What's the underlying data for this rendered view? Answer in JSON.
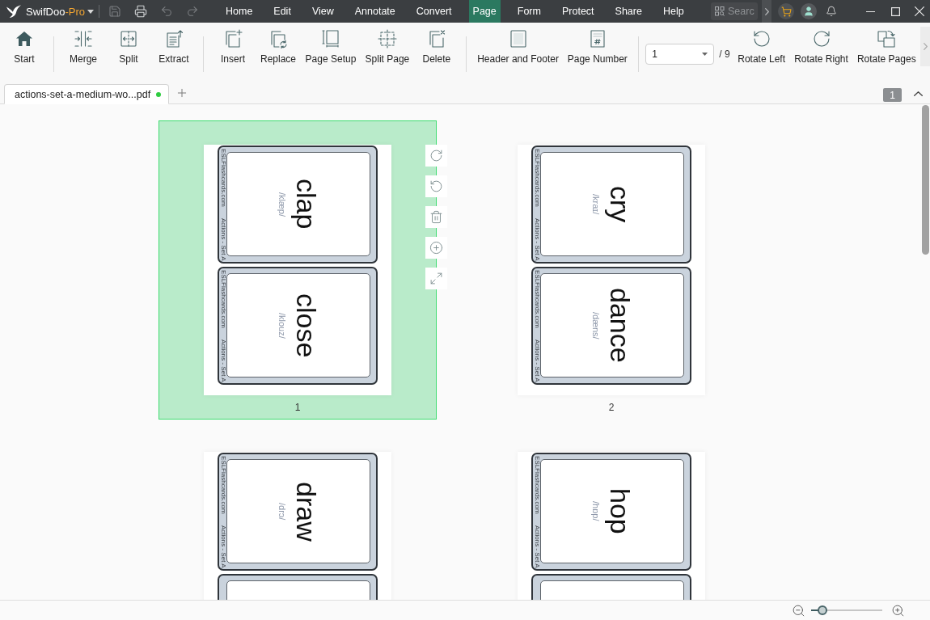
{
  "app_title": {
    "name": "SwifDoo",
    "edition": "-Pro"
  },
  "quick_actions": [
    {
      "disabled": true
    },
    {
      "disabled": false
    },
    {
      "disabled": true
    },
    {
      "disabled": true
    }
  ],
  "menu": [
    {
      "label": "Home",
      "selected": false
    },
    {
      "label": "Edit",
      "selected": false
    },
    {
      "label": "View",
      "selected": false
    },
    {
      "label": "Annotate",
      "selected": false
    },
    {
      "label": "Convert",
      "selected": false
    },
    {
      "label": "Page",
      "selected": true
    },
    {
      "label": "Form",
      "selected": false
    },
    {
      "label": "Protect",
      "selected": false
    },
    {
      "label": "Share",
      "selected": false
    },
    {
      "label": "Help",
      "selected": false
    }
  ],
  "search": {
    "placeholder": "Searc"
  },
  "toolbar": {
    "groups": [
      [
        {
          "label": "Start"
        }
      ],
      [
        {
          "label": "Merge"
        },
        {
          "label": "Split"
        },
        {
          "label": "Extract"
        }
      ],
      [
        {
          "label": "Insert"
        },
        {
          "label": "Replace"
        },
        {
          "label": "Page Setup"
        },
        {
          "label": "Split Page"
        },
        {
          "label": "Delete"
        }
      ],
      [
        {
          "label": "Header and Footer"
        },
        {
          "label": "Page Number"
        }
      ]
    ],
    "page_select": {
      "value": "1"
    },
    "page_total": "/ 9",
    "rotate_buttons": [
      {
        "label": "Rotate Left"
      },
      {
        "label": "Rotate Right"
      },
      {
        "label": "Rotate Pages"
      }
    ]
  },
  "document_tab": {
    "label": "actions-set-a-medium-wo...pdf",
    "selected": true,
    "status_dot": true
  },
  "page_indicator": "1",
  "pages": [
    {
      "number": "1",
      "selected": true,
      "cards": [
        {
          "word": "clap",
          "phonetic": "/klæp/",
          "site": "ESLFlashcards.com",
          "set": "Actions - Set A"
        },
        {
          "word": "close",
          "phonetic": "/klouz/",
          "site": "ESLFlashcards.com",
          "set": "Actions - Set A"
        }
      ]
    },
    {
      "number": "2",
      "selected": false,
      "cards": [
        {
          "word": "cry",
          "phonetic": "/kraɪ/",
          "site": "ESLFlashcards.com",
          "set": "Actions - Set A"
        },
        {
          "word": "dance",
          "phonetic": "/dæns/",
          "site": "ESLFlashcards.com",
          "set": "Actions - Set A"
        }
      ]
    },
    {
      "selected": false,
      "cards": [
        {
          "word": "draw",
          "phonetic": "/drɔ/",
          "site": "ESLFlashcards.com",
          "set": "Actions - Set A"
        }
      ]
    },
    {
      "selected": false,
      "cards": [
        {
          "word": "hop",
          "phonetic": "/hɒp/",
          "site": "ESLFlashcards.com",
          "set": "Actions - Set A"
        }
      ]
    }
  ],
  "zoom": {
    "level": 0.16
  }
}
